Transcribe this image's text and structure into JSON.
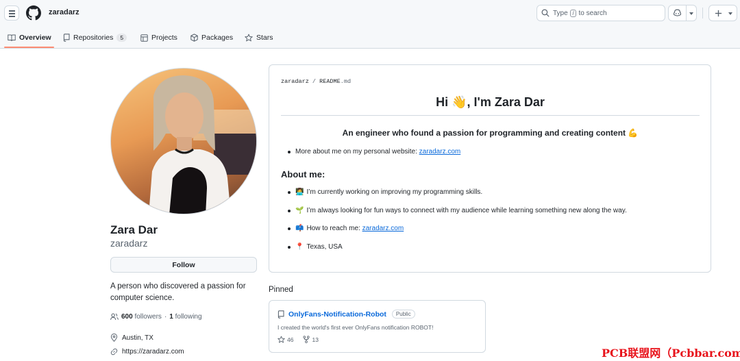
{
  "header": {
    "username": "zaradarz",
    "search": {
      "prefix": "Type",
      "key": "/",
      "suffix": "to search"
    }
  },
  "tabs": [
    {
      "label": "Overview",
      "icon": "book-icon",
      "selected": true
    },
    {
      "label": "Repositories",
      "icon": "repo-icon",
      "count": "5"
    },
    {
      "label": "Projects",
      "icon": "table-icon"
    },
    {
      "label": "Packages",
      "icon": "package-icon"
    },
    {
      "label": "Stars",
      "icon": "star-icon"
    }
  ],
  "profile": {
    "name": "Zara Dar",
    "login": "zaradarz",
    "follow_label": "Follow",
    "bio": "A person who discovered a passion for computer science.",
    "followers_count": "600",
    "followers_label": "followers",
    "following_count": "1",
    "following_label": "following",
    "location": "Austin, TX",
    "website": "https://zaradarz.com"
  },
  "readme": {
    "path_user": "zaradarz",
    "path_sep": "/",
    "path_file": "README",
    "path_ext": ".md",
    "heading": "Hi 👋, I'm Zara Dar",
    "subheading": "An engineer who found a passion for programming and creating content 💪",
    "intro_text": "More about me on my personal website: ",
    "intro_link": "zaradarz.com",
    "about_title": "About me:",
    "items": [
      {
        "emoji": "👩‍💻",
        "text": "I’m currently working on improving my programming skills."
      },
      {
        "emoji": "🌱",
        "text": "I’m always looking for fun ways to connect with my audience while learning something new along the way."
      },
      {
        "emoji": "📫",
        "text": "How to reach me: ",
        "link": "zaradarz.com"
      },
      {
        "emoji": "📍",
        "text": "Texas, USA"
      }
    ]
  },
  "pinned": {
    "title": "Pinned",
    "repo_name": "OnlyFans-Notification-Robot",
    "visibility": "Public",
    "description": "I created the world's first ever OnlyFans notification ROBOT!",
    "stars": "46",
    "forks": "13"
  },
  "watermark": "PCB联盟网（Pcbbar.com）",
  "colors": {
    "accent": "#0969da",
    "tab_underline": "#fd8c73",
    "watermark": "#e8141c"
  }
}
